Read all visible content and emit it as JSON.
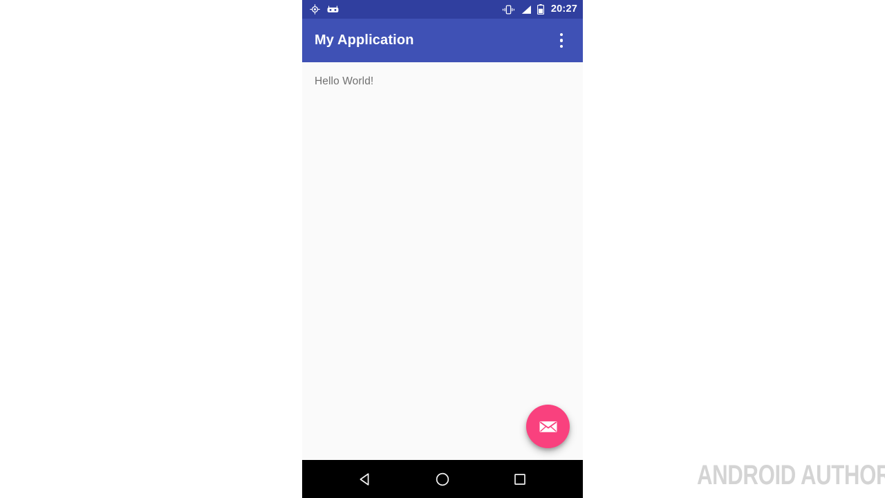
{
  "device": {
    "status_bar": {
      "left_icons": [
        {
          "name": "gps-location-icon",
          "label": "GPS location active"
        },
        {
          "name": "adb-robot-icon",
          "label": "ADB debugging"
        }
      ],
      "right_icons": [
        {
          "name": "vibrate-mode-icon",
          "label": "Vibrate mode"
        },
        {
          "name": "signal-strength-icon",
          "label": "Cellular signal"
        },
        {
          "name": "battery-icon",
          "label": "Battery"
        }
      ],
      "clock": "20:27",
      "background_color": "#303F9F"
    },
    "app_bar": {
      "title": "My Application",
      "overflow_menu_label": "More options",
      "background_color": "#3F51B5",
      "title_color": "#FFFFFF"
    },
    "content": {
      "hello_text": "Hello World!",
      "text_color": "#707070",
      "background_color": "#FAFAFA"
    },
    "fab": {
      "icon_name": "email-envelope-icon",
      "label": "Send email",
      "color": "#F9417E",
      "icon_color": "#FFFFFF"
    },
    "nav_bar": {
      "background_color": "#000000",
      "buttons": [
        {
          "name": "back-button",
          "icon": "triangle-left-icon",
          "label": "Back"
        },
        {
          "name": "home-button",
          "icon": "circle-icon",
          "label": "Home"
        },
        {
          "name": "recents-button",
          "icon": "square-icon",
          "label": "Recent apps"
        }
      ]
    }
  },
  "watermark": {
    "text": "ANDROID AUTHORITY",
    "color": "#D4D4D4"
  },
  "page": {
    "background_color": "#FFFFFF"
  }
}
